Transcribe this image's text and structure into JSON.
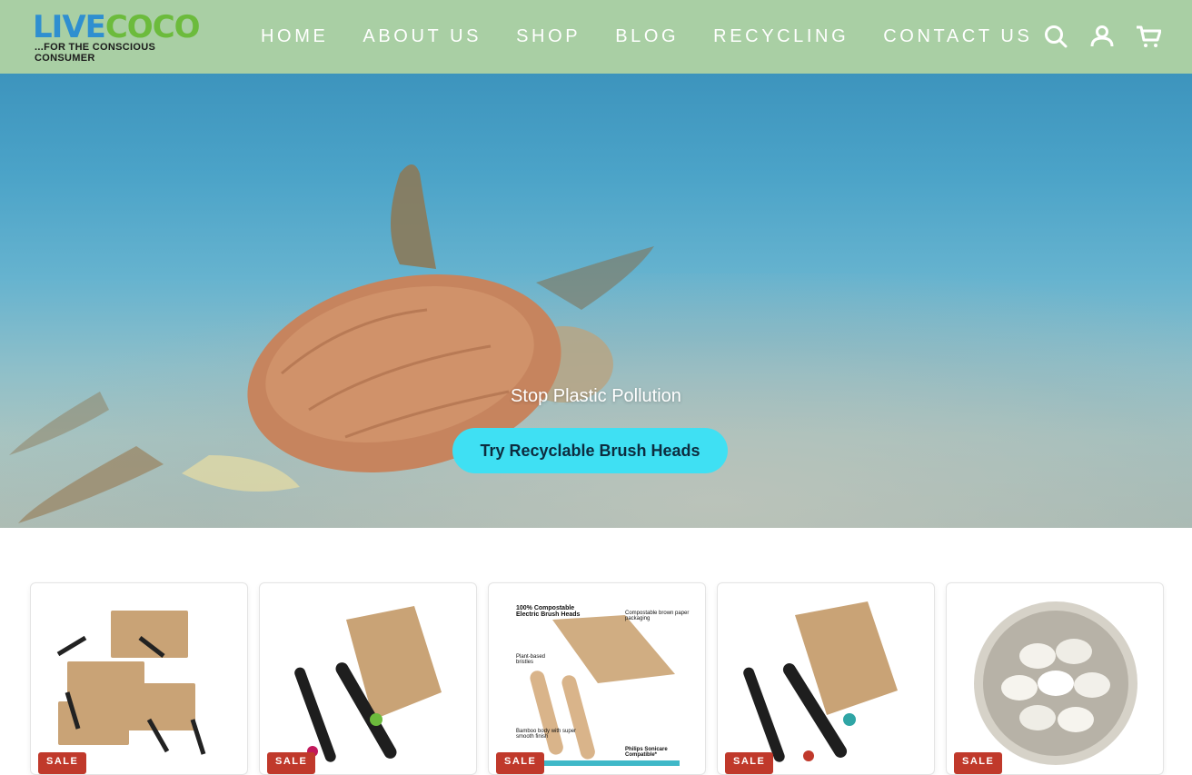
{
  "brand": {
    "logo_part1": "LIVE",
    "logo_part2": "COCO",
    "tagline": "...FOR THE CONSCIOUS CONSUMER"
  },
  "nav": {
    "items": [
      "HOME",
      "ABOUT US",
      "SHOP",
      "BLOG",
      "RECYCLING",
      "CONTACT US"
    ]
  },
  "header_icons": [
    "search-icon",
    "account-icon",
    "cart-icon"
  ],
  "hero": {
    "headline": "Stop Plastic Pollution",
    "cta_label": "Try Recyclable Brush Heads"
  },
  "products": [
    {
      "badge": "SALE"
    },
    {
      "badge": "SALE"
    },
    {
      "badge": "SALE",
      "image_text": [
        "100% Compostable Electric Brush Heads",
        "Compostable brown paper packaging",
        "Plant-based bristles",
        "Bamboo body with super smooth finish",
        "Philips Sonicare Compatible*"
      ]
    },
    {
      "badge": "SALE"
    },
    {
      "badge": "SALE"
    }
  ],
  "colors": {
    "header_bg": "#a9cfa4",
    "cta_bg": "#3fe0f3",
    "sale_badge": "#c0392b",
    "logo_blue": "#2f8fd0",
    "logo_green": "#6cbb3c"
  }
}
